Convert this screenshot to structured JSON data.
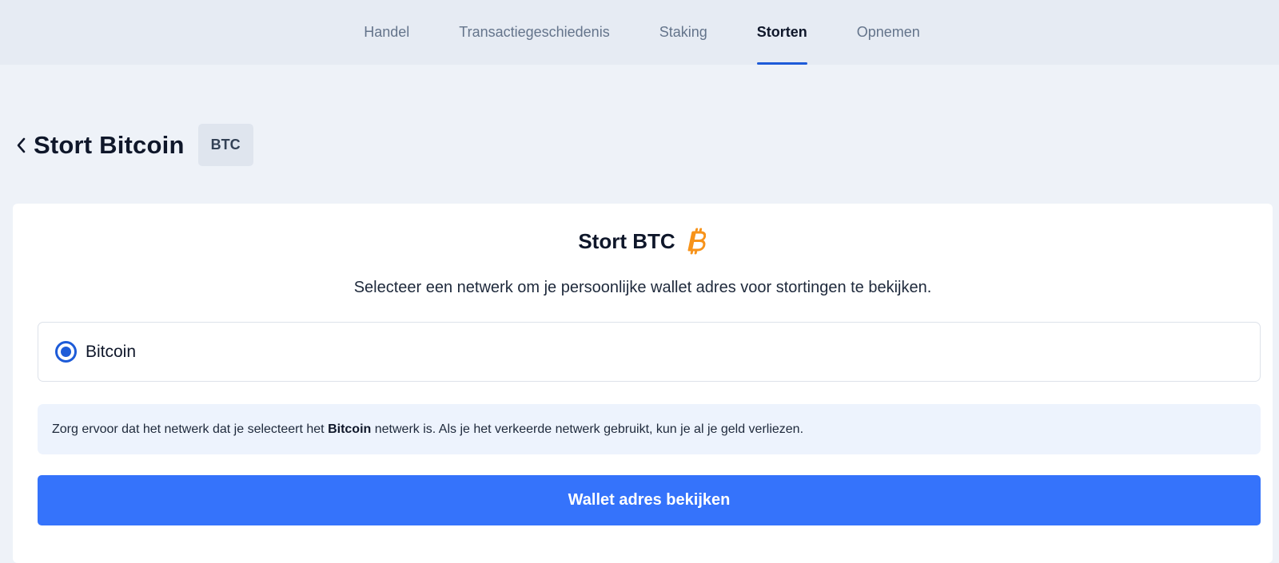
{
  "nav": {
    "tabs": [
      {
        "label": "Handel",
        "active": false
      },
      {
        "label": "Transactiegeschiedenis",
        "active": false
      },
      {
        "label": "Staking",
        "active": false
      },
      {
        "label": "Storten",
        "active": true
      },
      {
        "label": "Opnemen",
        "active": false
      }
    ]
  },
  "header": {
    "back_icon": "chevron-left-icon",
    "title": "Stort Bitcoin",
    "ticker": "BTC"
  },
  "card": {
    "title": "Stort BTC",
    "coin_icon": "bitcoin-icon",
    "subtitle": "Selecteer een netwerk om je persoonlijke wallet adres voor stortingen te bekijken.",
    "network": {
      "label": "Bitcoin",
      "selected": true
    },
    "warning": {
      "before": "Zorg ervoor dat het netwerk dat je selecteert het ",
      "highlight": "Bitcoin",
      "after": " netwerk is. Als je het verkeerde netwerk gebruikt, kun je al je geld verliezen."
    },
    "primary_button": "Wallet adres bekijken"
  },
  "colors": {
    "accent": "#1d5bd8",
    "button": "#3573fb",
    "bitcoin": "#f7931a"
  }
}
